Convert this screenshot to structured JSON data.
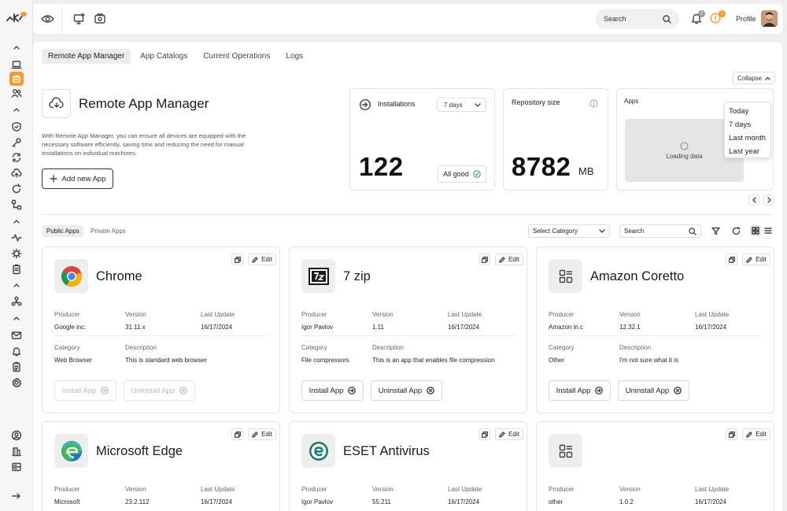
{
  "topbar": {
    "search_placeholder": "Search",
    "notifications_badge": "0",
    "alerts_badge": "2",
    "profile_label": "Profile"
  },
  "tabs": [
    "Remote App Manager",
    "App Catalogs",
    "Current Operations",
    "Logs"
  ],
  "collapse_label": "Collapse",
  "hero": {
    "title": "Remote App Manager",
    "description": "With Remote App Manager, you can ensure all devices are equipped with the necessary software efficiently, saving time and reducing the need for manual installations on individual machines.",
    "add_button": "Add new App"
  },
  "stats": {
    "installations": {
      "title": "Installations",
      "period": "7 days",
      "value": "122",
      "status": "All good"
    },
    "repository": {
      "title": "Repository size",
      "value": "8782",
      "unit": "MB"
    },
    "apps": {
      "title": "Apps",
      "loading": "Loading data"
    }
  },
  "period_options": [
    "Today",
    "7 days",
    "Last month",
    "Last  year"
  ],
  "list": {
    "subtabs": [
      "Public Apps",
      "Private Apps"
    ],
    "category_placeholder": "Select Category",
    "search_placeholder": "Search"
  },
  "labels": {
    "producer": "Producer",
    "version": "Version",
    "last_update": "Last Update",
    "category": "Category",
    "description": "Description",
    "edit": "Edit",
    "install": "Install App",
    "uninstall": "Uninstall App"
  },
  "apps": [
    {
      "name": "Chrome",
      "producer": "Google inc.",
      "version": "31.11.x",
      "last_update": "16/17/2024",
      "category": "Web Browser",
      "description": "This is standard web browser",
      "logo": "chrome-logo",
      "actions_enabled": false
    },
    {
      "name": "7 zip",
      "producer": "Igor Pavlov",
      "version": "1.11",
      "last_update": "16/17/2024",
      "category": "File compressors",
      "description": "This is an app that enables file compression",
      "logo": "7zip-logo",
      "actions_enabled": true
    },
    {
      "name": "Amazon Coretto",
      "producer": "Amazon in.c",
      "version": "12.32.1",
      "last_update": "16/17/2024",
      "category": "Other",
      "description": "I'm not sure what it is",
      "logo": "generic-app-icon",
      "actions_enabled": true
    },
    {
      "name": "Microsoft Edge",
      "producer": "Microsoft",
      "version": "23.2.112",
      "last_update": "16/17/2024",
      "logo": "edge-logo"
    },
    {
      "name": "ESET Antivirus",
      "producer": "Igor Pavlov",
      "version": "55.211",
      "last_update": "16/17/2024",
      "logo": "eset-logo"
    },
    {
      "name": "",
      "producer": "other",
      "version": "1.0.2",
      "last_update": "16/17/2024",
      "logo": "generic-app-icon"
    }
  ],
  "colors": {
    "accent": "#f39a2a",
    "green": "#2e9b5f",
    "edge_blue": "#1a73c9",
    "eset_teal": "#0f7c74"
  }
}
